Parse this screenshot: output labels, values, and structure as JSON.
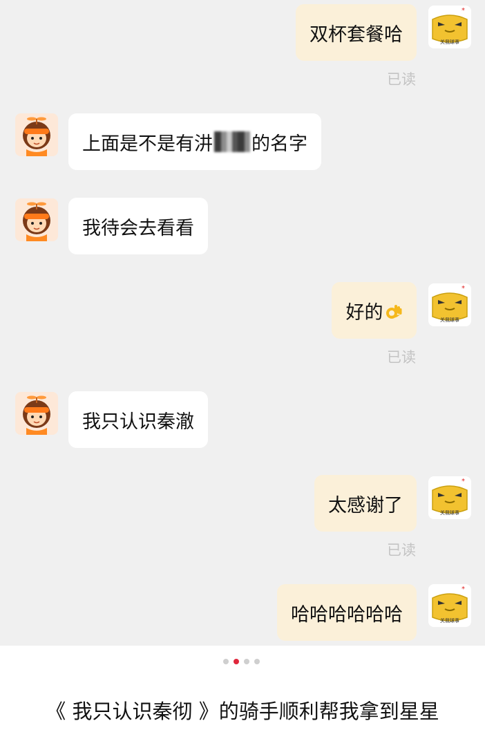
{
  "messages": {
    "m1": "双杯套餐哈",
    "m2_before": "上面是不是有",
    "m2_partial": "汫",
    "m2_after": "的名字",
    "m3": "我待会去看看",
    "m4": "好的",
    "m5": "我只认识秦澈",
    "m6": "太感谢了",
    "m7": "哈哈哈哈哈哈"
  },
  "read_label": "已读",
  "avatar_badge_text": "关我球事",
  "carousel": {
    "total": 4,
    "active_index": 2
  },
  "caption": "《 我只认识秦彻 》的骑手顺利帮我拿到星星",
  "colors": {
    "chat_bg": "#f0f0f0",
    "outgoing_bubble": "#fbf0d9",
    "incoming_bubble": "#ffffff",
    "read_text": "#c3c3c3",
    "active_dot": "#e0273c"
  }
}
